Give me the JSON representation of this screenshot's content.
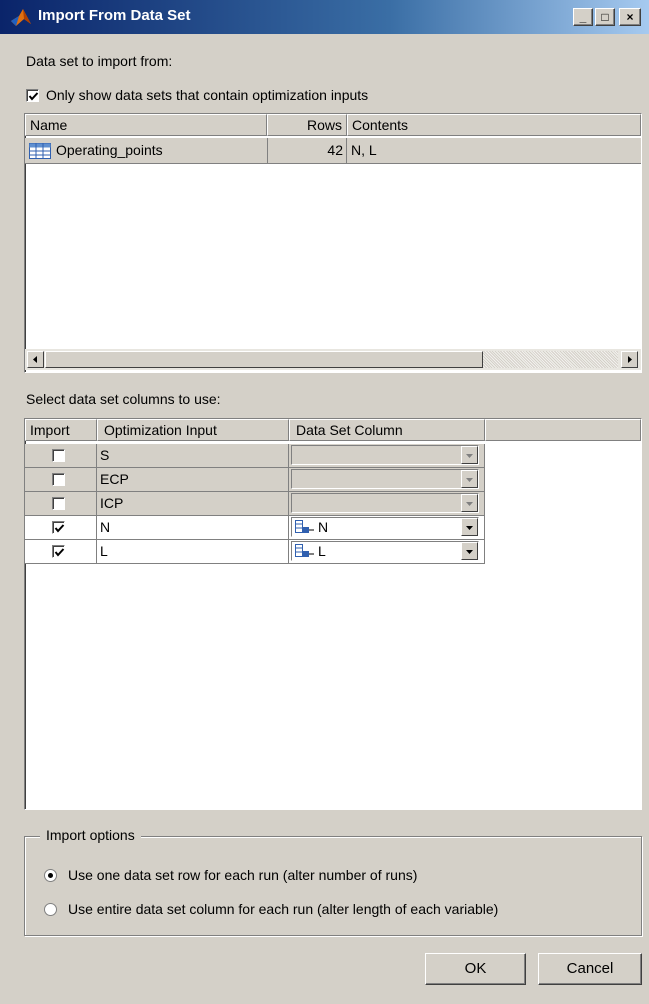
{
  "window": {
    "title": "Import From Data Set",
    "controls": {
      "minimize": "_",
      "maximize": "□",
      "close": "×"
    }
  },
  "source": {
    "label": "Data set to import from:",
    "filter_checkbox": {
      "label": "Only show data sets that contain optimization inputs",
      "checked": true
    },
    "table": {
      "headers": [
        "Name",
        "Rows",
        "Contents"
      ],
      "rows": [
        {
          "name": "Operating_points",
          "rows": "42",
          "contents": "N, L",
          "icon": "table-icon"
        }
      ]
    }
  },
  "columns": {
    "label": "Select data set columns to use:",
    "headers": [
      "Import",
      "Optimization Input",
      "Data Set Column"
    ],
    "rows": [
      {
        "import": false,
        "input": "S",
        "column": "",
        "enabled": false
      },
      {
        "import": false,
        "input": "ECP",
        "column": "",
        "enabled": false
      },
      {
        "import": false,
        "input": "ICP",
        "column": "",
        "enabled": false
      },
      {
        "import": true,
        "input": "N",
        "column": "N",
        "enabled": true,
        "icon": "dataset-column-icon"
      },
      {
        "import": true,
        "input": "L",
        "column": "L",
        "enabled": true,
        "icon": "dataset-column-icon"
      }
    ]
  },
  "import_options": {
    "legend": "Import options",
    "options": [
      {
        "label": "Use one data set row for each run (alter number of runs)",
        "selected": true
      },
      {
        "label": "Use entire data set column for each run (alter length of each variable)",
        "selected": false
      }
    ]
  },
  "buttons": {
    "ok": "OK",
    "cancel": "Cancel"
  }
}
